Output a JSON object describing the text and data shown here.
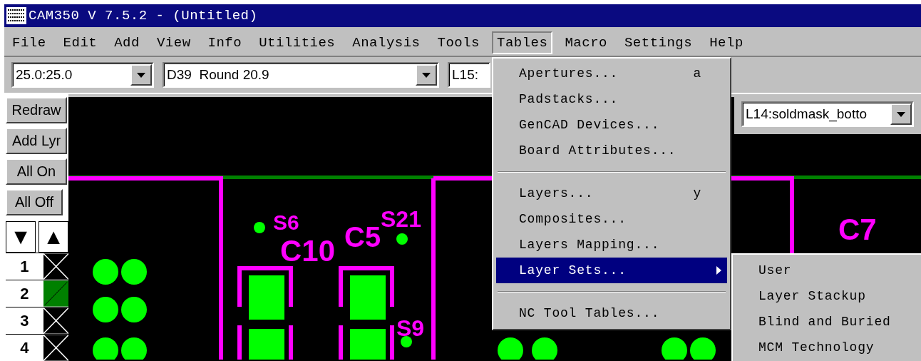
{
  "window": {
    "title": "CAM350 V 7.5.2 - (Untitled)"
  },
  "menu_bar": [
    {
      "label": "File",
      "selected": false
    },
    {
      "label": "Edit",
      "selected": false
    },
    {
      "label": "Add",
      "selected": false
    },
    {
      "label": "View",
      "selected": false
    },
    {
      "label": "Info",
      "selected": false
    },
    {
      "label": "Utilities",
      "selected": false
    },
    {
      "label": "Analysis",
      "selected": false
    },
    {
      "label": "Tools",
      "selected": false
    },
    {
      "label": "Tables",
      "selected": true
    },
    {
      "label": "Macro",
      "selected": false
    },
    {
      "label": "Settings",
      "selected": false
    },
    {
      "label": "Help",
      "selected": false
    }
  ],
  "toolbar": {
    "combos": [
      {
        "value": "25.0:25.0"
      },
      {
        "value": "D39  Round 20.9"
      },
      {
        "value": "L15:"
      }
    ]
  },
  "layer_selector": {
    "value": "L14:soldmask_botto"
  },
  "left_panel": {
    "buttons": [
      "Redraw",
      "Add Lyr",
      "All On",
      "All Off"
    ],
    "arrows": [
      "▼",
      "▲"
    ],
    "layers": [
      {
        "number": "1",
        "visible": false
      },
      {
        "number": "2",
        "visible": true
      },
      {
        "number": "3",
        "visible": false
      },
      {
        "number": "4",
        "visible": false
      }
    ]
  },
  "board_labels": [
    "S6",
    "C10",
    "C5",
    "S21",
    "S9",
    "C7"
  ],
  "tables_menu": {
    "items": [
      {
        "kind": "item",
        "label": "Apertures...",
        "shortcut": "a",
        "selected": false
      },
      {
        "kind": "item",
        "label": "Padstacks...",
        "selected": false
      },
      {
        "kind": "item",
        "label": "GenCAD Devices...",
        "selected": false
      },
      {
        "kind": "item",
        "label": "Board Attributes...",
        "selected": false
      },
      {
        "kind": "separator"
      },
      {
        "kind": "item",
        "label": "Layers...",
        "shortcut": "y",
        "selected": false
      },
      {
        "kind": "item",
        "label": "Composites...",
        "selected": false
      },
      {
        "kind": "item",
        "label": "Layers Mapping...",
        "selected": false
      },
      {
        "kind": "item",
        "label": "Layer Sets...",
        "selected": true,
        "submenu": true
      },
      {
        "kind": "separator"
      },
      {
        "kind": "item",
        "label": "NC Tool Tables...",
        "selected": false
      }
    ]
  },
  "layer_sets_submenu": {
    "items": [
      {
        "label": "User"
      },
      {
        "label": "Layer Stackup"
      },
      {
        "label": "Blind and Buried"
      },
      {
        "label": "MCM Technology"
      }
    ]
  }
}
